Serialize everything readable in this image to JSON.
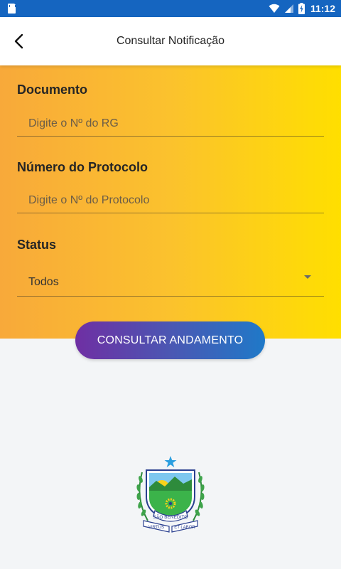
{
  "status_bar": {
    "time": "11:12",
    "battery_level": "full",
    "icons": [
      "sd-card-icon",
      "wifi-icon",
      "cell-signal-icon",
      "battery-icon"
    ],
    "color": "#1565c0"
  },
  "app_bar": {
    "title": "Consultar Notificação",
    "back_icon": "back-arrow-icon"
  },
  "form": {
    "documento": {
      "label": "Documento",
      "placeholder": "Digite o Nº do RG",
      "value": ""
    },
    "protocolo": {
      "label": "Número do Protocolo",
      "placeholder": "Digite o Nº do Protocolo",
      "value": ""
    },
    "status": {
      "label": "Status",
      "selected": "Todos"
    },
    "gradient_colors": [
      "#f8a93a",
      "#ffdf00"
    ]
  },
  "submit": {
    "label": "CONSULTAR ANDAMENTO",
    "gradient_colors": [
      "#6f2fa3",
      "#1f79c8"
    ]
  },
  "crest": {
    "icon": "municipal-crest-icon",
    "banner_text": "SÃO BENEDITO",
    "motto_left": "VIRTUS",
    "motto_right": "ET LABOR"
  }
}
